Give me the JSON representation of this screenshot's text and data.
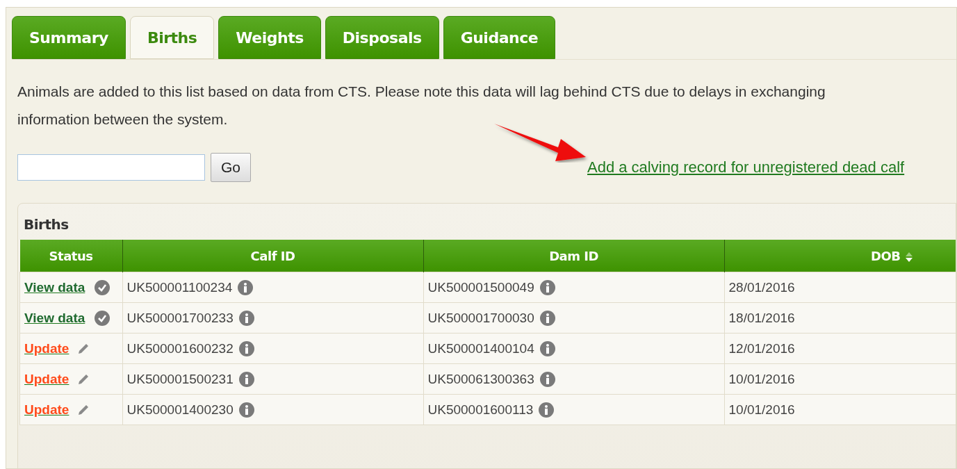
{
  "tabs": [
    {
      "label": "Summary",
      "selected": false
    },
    {
      "label": "Births",
      "selected": true
    },
    {
      "label": "Weights",
      "selected": false
    },
    {
      "label": "Disposals",
      "selected": false
    },
    {
      "label": "Guidance",
      "selected": false
    }
  ],
  "notice": "Animals are added to this list based on data from CTS. Please note this data will lag behind CTS due to delays in exchanging information between the system.",
  "search": {
    "button": "Go"
  },
  "add_link": "Add a calving record for unregistered dead calf",
  "births": {
    "title": "Births",
    "columns": [
      {
        "label": "Status",
        "sortable": false
      },
      {
        "label": "Calf ID",
        "sortable": false
      },
      {
        "label": "Dam ID",
        "sortable": false
      },
      {
        "label": "DOB",
        "sortable": true
      }
    ],
    "rows": [
      {
        "kind": "view",
        "status": "View data",
        "calf_id": "UK500001100234",
        "dam_id": "UK500001500049",
        "dob": "28/01/2016"
      },
      {
        "kind": "view",
        "status": "View data",
        "calf_id": "UK500001700233",
        "dam_id": "UK500001700030",
        "dob": "18/01/2016"
      },
      {
        "kind": "update",
        "status": "Update",
        "calf_id": "UK500001600232",
        "dam_id": "UK500001400104",
        "dob": "12/01/2016"
      },
      {
        "kind": "update",
        "status": "Update",
        "calf_id": "UK500001500231",
        "dam_id": "UK500061300363",
        "dob": "10/01/2016"
      },
      {
        "kind": "update",
        "status": "Update",
        "calf_id": "UK500001400230",
        "dam_id": "UK500001600113",
        "dob": "10/01/2016"
      }
    ]
  }
}
